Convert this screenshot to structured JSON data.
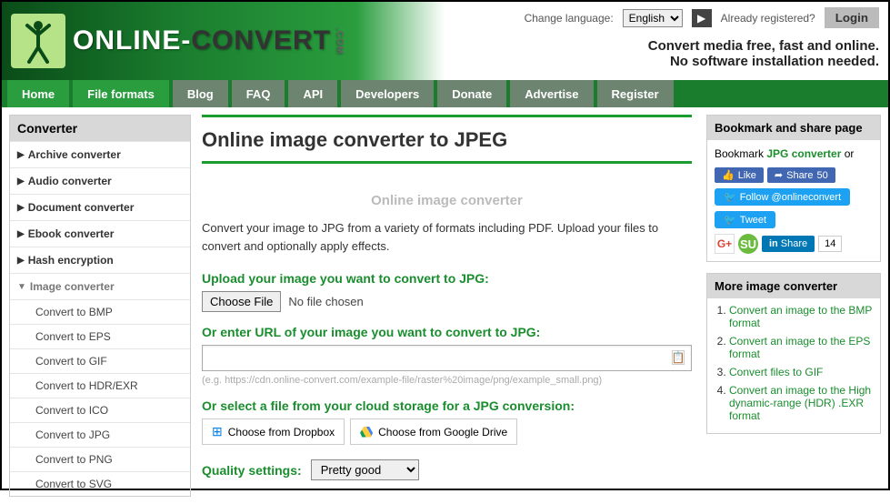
{
  "topbar": {
    "change_lang": "Change language:",
    "lang_value": "English",
    "lang_go": "▶",
    "already": "Already registered?",
    "login": "Login"
  },
  "brand": {
    "online": "ONLINE-",
    "convert": "CONVERT",
    "dotcom": ".COM"
  },
  "tagline": {
    "l1": "Convert media free, fast and online.",
    "l2": "No software installation needed."
  },
  "nav": [
    "Home",
    "File formats",
    "Blog",
    "FAQ",
    "API",
    "Developers",
    "Donate",
    "Advertise",
    "Register"
  ],
  "sidebar": {
    "title": "Converter",
    "items": [
      {
        "label": "Archive converter"
      },
      {
        "label": "Audio converter"
      },
      {
        "label": "Document converter"
      },
      {
        "label": "Ebook converter"
      },
      {
        "label": "Hash encryption"
      },
      {
        "label": "Image converter",
        "expanded": true,
        "subs": [
          "Convert to BMP",
          "Convert to EPS",
          "Convert to GIF",
          "Convert to HDR/EXR",
          "Convert to ICO",
          "Convert to JPG",
          "Convert to PNG",
          "Convert to SVG"
        ]
      }
    ]
  },
  "main": {
    "title": "Online image converter to JPEG",
    "subtitle": "Online image converter",
    "desc": "Convert your image to JPG from a variety of formats including PDF. Upload your files to convert and optionally apply effects.",
    "upload_label": "Upload your image you want to convert to JPG:",
    "choose_file": "Choose File",
    "no_file": "No file chosen",
    "url_label": "Or enter URL of your image you want to convert to JPG:",
    "url_hint": "(e.g. https://cdn.online-convert.com/example-file/raster%20image/png/example_small.png)",
    "cloud_label": "Or select a file from your cloud storage for a JPG conversion:",
    "dropbox": "Choose from Dropbox",
    "gdrive": "Choose from Google Drive",
    "quality_label": "Quality settings:",
    "quality_value": "Pretty good"
  },
  "right": {
    "bookmark_title": "Bookmark and share page",
    "bookmark_pre": "Bookmark ",
    "bookmark_link": "JPG converter",
    "bookmark_post": " or",
    "like": "Like",
    "share": "Share",
    "share_count": "50",
    "follow": "Follow @onlineconvert",
    "tweet": "Tweet",
    "gplus": "G+",
    "su": "SU",
    "in_share": "Share",
    "in_count": "14",
    "more_title": "More image converter",
    "more_items": [
      "Convert an image to the BMP format",
      "Convert an image to the EPS format",
      "Convert files to GIF",
      "Convert an image to the High dynamic-range (HDR) .EXR format"
    ]
  }
}
